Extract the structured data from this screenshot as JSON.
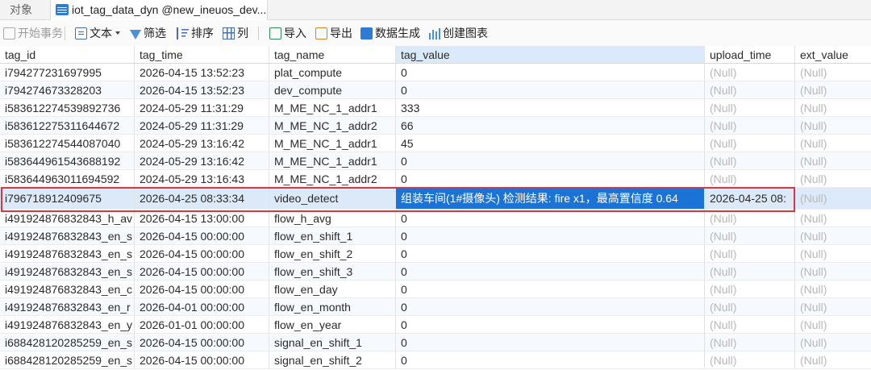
{
  "tabs": {
    "objects_label": "对象",
    "table_label": "iot_tag_data_dyn @new_ineuos_dev..."
  },
  "toolbar": {
    "begin_transaction": "开始事务",
    "text": "文本",
    "filter": "筛选",
    "sort": "排序",
    "columns": "列",
    "import": "导入",
    "export": "导出",
    "data_generation": "数据生成",
    "create_chart": "创建图表"
  },
  "grid": {
    "columns": [
      "tag_id",
      "tag_time",
      "tag_name",
      "tag_value",
      "upload_time",
      "ext_value"
    ],
    "rows": [
      [
        "i794277231697995",
        "2026-04-15 13:52:23",
        "plat_compute",
        "0",
        "(Null)",
        "(Null)"
      ],
      [
        "i794274673328203",
        "2026-04-15 13:52:23",
        "dev_compute",
        "0",
        "(Null)",
        "(Null)"
      ],
      [
        "i583612274539892736",
        "2024-05-29 11:31:29",
        "M_ME_NC_1_addr1",
        "333",
        "(Null)",
        "(Null)"
      ],
      [
        "i583612275311644672",
        "2024-05-29 11:31:29",
        "M_ME_NC_1_addr2",
        "66",
        "(Null)",
        "(Null)"
      ],
      [
        "i583612274544087040",
        "2024-05-29 13:16:42",
        "M_ME_NC_1_addr1",
        "45",
        "(Null)",
        "(Null)"
      ],
      [
        "i583644961543688192",
        "2024-05-29 13:16:42",
        "M_ME_NC_1_addr1",
        "0",
        "(Null)",
        "(Null)"
      ],
      [
        "i583644963011694592",
        "2024-05-29 13:16:43",
        "M_ME_NC_1_addr2",
        "0",
        "(Null)",
        "(Null)"
      ],
      [
        "i796718912409675",
        "2026-04-25 08:33:34",
        "video_detect",
        "组装车间(1#摄像头) 检测结果: fire x1，最高置信度 0.64",
        "2026-04-25 08:",
        "(Null)"
      ],
      [
        "i491924876832843_h_av",
        "2026-04-15 13:00:00",
        "flow_h_avg",
        "0",
        "(Null)",
        "(Null)"
      ],
      [
        "i491924876832843_en_s",
        "2026-04-15 00:00:00",
        "flow_en_shift_1",
        "0",
        "(Null)",
        "(Null)"
      ],
      [
        "i491924876832843_en_s",
        "2026-04-15 00:00:00",
        "flow_en_shift_2",
        "0",
        "(Null)",
        "(Null)"
      ],
      [
        "i491924876832843_en_s",
        "2026-04-15 00:00:00",
        "flow_en_shift_3",
        "0",
        "(Null)",
        "(Null)"
      ],
      [
        "i491924876832843_en_c",
        "2026-04-15 00:00:00",
        "flow_en_day",
        "0",
        "(Null)",
        "(Null)"
      ],
      [
        "i491924876832843_en_r",
        "2026-04-01 00:00:00",
        "flow_en_month",
        "0",
        "(Null)",
        "(Null)"
      ],
      [
        "i491924876832843_en_y",
        "2026-01-01 00:00:00",
        "flow_en_year",
        "0",
        "(Null)",
        "(Null)"
      ],
      [
        "i688428120285259_en_s",
        "2026-04-15 00:00:00",
        "signal_en_shift_1",
        "0",
        "(Null)",
        "(Null)"
      ],
      [
        "i688428120285259_en_s",
        "2026-04-15 00:00:00",
        "signal_en_shift_2",
        "0",
        "(Null)",
        "(Null)"
      ]
    ]
  },
  "colors": {
    "selection": "#1c73d6",
    "highlight_border": "#d9363e",
    "null_text": "#b8b8b8"
  }
}
